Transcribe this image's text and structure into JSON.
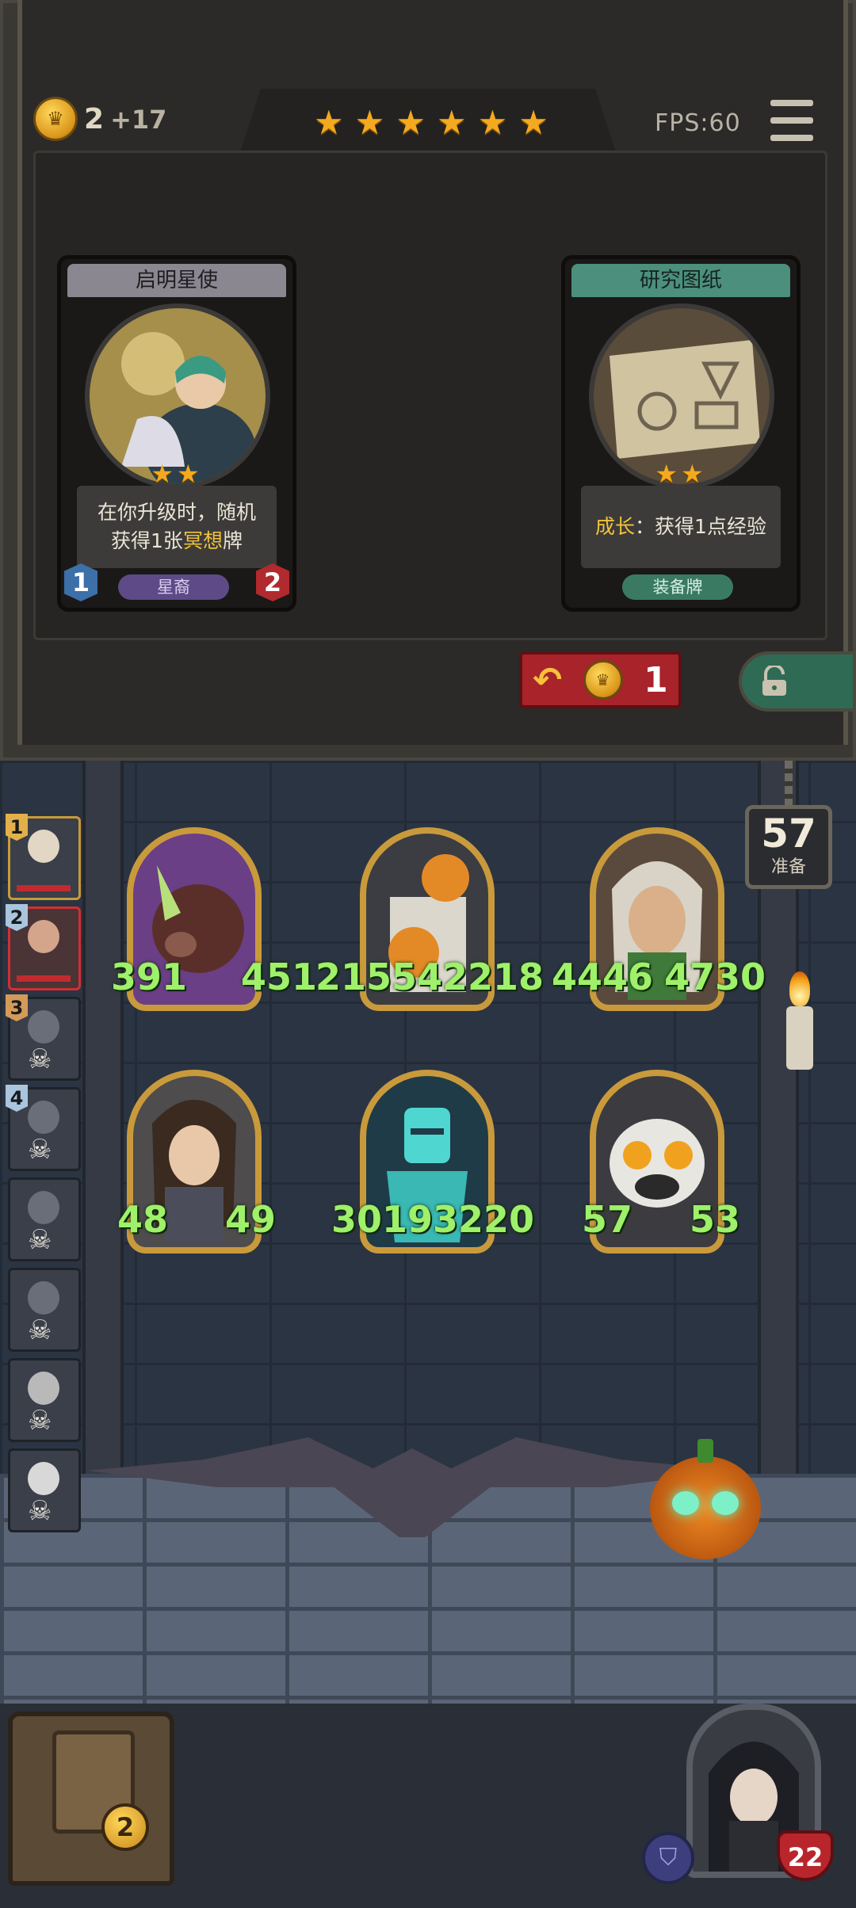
{
  "shop": {
    "gold": "2",
    "gold_income": "+17",
    "tavern_stars": 6,
    "fps": "FPS:60",
    "cards": [
      {
        "name": "启明星使",
        "stars": 2,
        "desc_line1": "在你升级时，随机",
        "desc_line2_a": "获得1张",
        "desc_line2_hl": "冥想",
        "desc_line2_b": "牌",
        "tag": "星裔",
        "attack": "1",
        "health": "2"
      },
      {
        "name": "研究图纸",
        "stars": 2,
        "desc_hl": "成长",
        "desc_rest": "：获得1点经验",
        "tag": "装备牌"
      }
    ],
    "refresh_cost": "1"
  },
  "battle": {
    "ready_count": "57",
    "ready_label": "准备",
    "lineup": [
      {
        "index": "1"
      },
      {
        "index": "2"
      },
      {
        "index": "3"
      },
      {
        "index": "4"
      },
      {
        "index": ""
      },
      {
        "index": ""
      },
      {
        "index": ""
      },
      {
        "index": ""
      }
    ],
    "units": [
      {
        "name": "boar-beast",
        "attack": "391",
        "health": "451"
      },
      {
        "name": "pumpkin-scarecrow",
        "attack": "2155",
        "health": "42218"
      },
      {
        "name": "old-hag",
        "attack": "4446",
        "health": "4730"
      },
      {
        "name": "hooded-girl",
        "attack": "48",
        "health": "49"
      },
      {
        "name": "ghost-knight",
        "attack": "3019",
        "health": "3220"
      },
      {
        "name": "bulldog",
        "attack": "57",
        "health": "53"
      }
    ],
    "chest_level": "2",
    "hero_health": "22"
  },
  "colors": {
    "gold": "#f4a91e",
    "stat_green": "#9ff06a",
    "refresh_red": "#a8232a",
    "lock_green": "#2f6a55",
    "frame_gold": "#c99a3c"
  }
}
